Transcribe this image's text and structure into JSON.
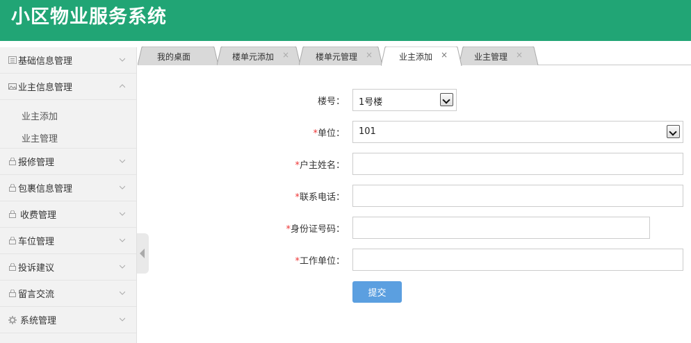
{
  "app": {
    "title": "小区物业服务系统"
  },
  "sidebar": {
    "items": [
      {
        "label": "基础信息管理",
        "icon": "list-icon",
        "expanded": false
      },
      {
        "label": "业主信息管理",
        "icon": "image-icon",
        "expanded": true
      },
      {
        "label": "报修管理",
        "icon": "lock-icon",
        "expanded": false
      },
      {
        "label": "包裹信息管理",
        "icon": "lock-icon",
        "expanded": false
      },
      {
        "label": "收费管理",
        "icon": "lock-icon",
        "expanded": false
      },
      {
        "label": "车位管理",
        "icon": "lock-icon",
        "expanded": false
      },
      {
        "label": "投诉建议",
        "icon": "lock-icon",
        "expanded": false
      },
      {
        "label": "留言交流",
        "icon": "lock-icon",
        "expanded": false
      },
      {
        "label": "系统管理",
        "icon": "gear-icon",
        "expanded": false
      }
    ],
    "subitems": [
      "业主添加",
      "业主管理"
    ]
  },
  "tabs": [
    {
      "label": "我的桌面",
      "closable": false,
      "active": false
    },
    {
      "label": "楼单元添加",
      "closable": true,
      "active": false
    },
    {
      "label": "楼单元管理",
      "closable": true,
      "active": false
    },
    {
      "label": "业主添加",
      "closable": true,
      "active": true
    },
    {
      "label": "业主管理",
      "closable": true,
      "active": false
    }
  ],
  "tab_close_glyph": "×",
  "form": {
    "building_label": "楼号：",
    "building_value": "1号楼",
    "unit_label": "单位：",
    "unit_value": "101",
    "owner_name_label": "户主姓名：",
    "phone_label": "联系电话：",
    "id_card_label": "身份证号码：",
    "workplace_label": "工作单位：",
    "required_mark": "*",
    "submit_label": "提交"
  },
  "colors": {
    "header": "#21a575",
    "submit": "#5b9fe0",
    "required": "#e33333"
  }
}
